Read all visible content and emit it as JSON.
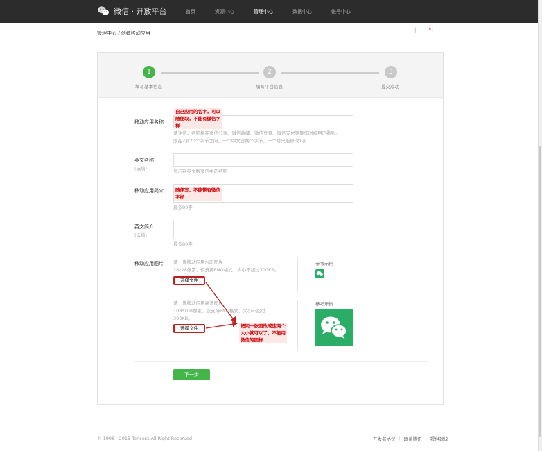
{
  "header": {
    "title": "微信 · 开放平台",
    "nav": [
      "首页",
      "资源中心",
      "管理中心",
      "数据中心",
      "帐号中心"
    ],
    "active_index": 2
  },
  "breadcrumb": "管理中心 / 创建移动应用",
  "steps": [
    {
      "number": "1",
      "label": "填写基本信息",
      "active": true
    },
    {
      "number": "2",
      "label": "填写平台信息",
      "active": false
    },
    {
      "number": "3",
      "label": "提交成功",
      "active": false
    }
  ],
  "form": {
    "app_name": {
      "label": "移动应用名称",
      "hint_line1": "请注意，名称将在微信分享、微信收藏、微信登录、微信支付等操作时被用户看到。",
      "hint_line2": "限在2到20个字节之间，一个中文占两个字节，一个月只能修改1次"
    },
    "en_name": {
      "label": "英文名称",
      "sub": "(选填)",
      "hint": "显示在英文版微信中的名称"
    },
    "app_intro": {
      "label": "移动应用简介",
      "hint": "最多80字"
    },
    "en_intro": {
      "label": "英文简介",
      "sub": "(选填)",
      "hint": "最多80字"
    },
    "app_image": {
      "label": "移动应用图片",
      "small_line1": "请上传移动应用水印图片",
      "small_line2": "28*28像素，仅支持PNG格式，大小不超过300KB。",
      "large_line1": "请上传移动应用高清图片",
      "large_line2": "108*108像素，仅支持PNG格式，大小不超过",
      "large_line3": "300KB。",
      "choose_label": "选择文件",
      "ref_label": "参考示例"
    },
    "next_label": "下一步"
  },
  "annotations": {
    "name_line1": "自己应用的名字，可以",
    "name_line2": "随便取，不能有微信字",
    "name_line3": "样",
    "intro_line1": "随便写，不能带有微信",
    "intro_line2": "字样",
    "image_line1": "把同一张图改成这两个",
    "image_line2": "大小就可以了，不能用",
    "image_line3": "微信的图标"
  },
  "footer": {
    "copyright": "© 1998 - 2015 Tencent All Right Reserved",
    "links": [
      "开发者协议",
      "联系腾讯",
      "提供建议"
    ]
  },
  "colors": {
    "accent": "#44b549",
    "annotation": "#c00000",
    "topbar": "#2c2c2c"
  }
}
